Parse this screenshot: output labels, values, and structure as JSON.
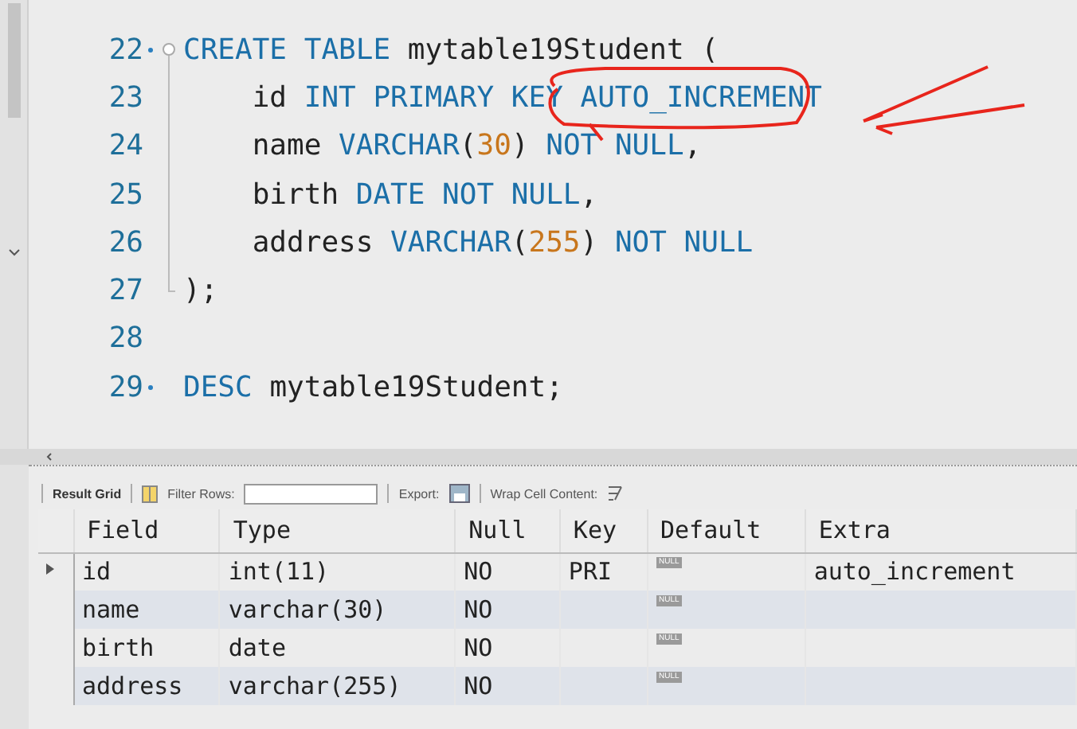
{
  "editor": {
    "lines": [
      {
        "number": "22",
        "marker": true,
        "kind": "fold-start",
        "tokens": [
          {
            "text": "CREATE TABLE",
            "kind": "keyword"
          },
          {
            "text": " mytable19Student (",
            "kind": "ident"
          }
        ]
      },
      {
        "number": "23",
        "marker": false,
        "kind": "fold-body",
        "tokens": [
          {
            "text": "    id ",
            "kind": "ident"
          },
          {
            "text": "INT PRIMARY KEY AUTO_INCREMENT",
            "kind": "keyword"
          }
        ]
      },
      {
        "number": "24",
        "marker": false,
        "kind": "fold-body",
        "tokens": [
          {
            "text": "    name ",
            "kind": "ident"
          },
          {
            "text": "VARCHAR",
            "kind": "keyword"
          },
          {
            "text": "(",
            "kind": "ident"
          },
          {
            "text": "30",
            "kind": "number"
          },
          {
            "text": ") ",
            "kind": "ident"
          },
          {
            "text": "NOT NULL",
            "kind": "keyword"
          },
          {
            "text": ",",
            "kind": "ident"
          }
        ]
      },
      {
        "number": "25",
        "marker": false,
        "kind": "fold-body",
        "tokens": [
          {
            "text": "    birth ",
            "kind": "ident"
          },
          {
            "text": "DATE NOT NULL",
            "kind": "keyword"
          },
          {
            "text": ",",
            "kind": "ident"
          }
        ]
      },
      {
        "number": "26",
        "marker": false,
        "kind": "fold-body",
        "tokens": [
          {
            "text": "    address ",
            "kind": "ident"
          },
          {
            "text": "VARCHAR",
            "kind": "keyword"
          },
          {
            "text": "(",
            "kind": "ident"
          },
          {
            "text": "255",
            "kind": "number"
          },
          {
            "text": ") ",
            "kind": "ident"
          },
          {
            "text": "NOT NULL",
            "kind": "keyword"
          }
        ]
      },
      {
        "number": "27",
        "marker": false,
        "kind": "fold-end",
        "tokens": [
          {
            "text": ");",
            "kind": "ident"
          }
        ]
      },
      {
        "number": "28",
        "marker": false,
        "kind": "plain"
      },
      {
        "number": "29",
        "marker": true,
        "kind": "plain",
        "tokens": [
          {
            "text": "DESC",
            "kind": "keyword"
          },
          {
            "text": " mytable19Student;",
            "kind": "ident"
          }
        ]
      }
    ]
  },
  "results": {
    "toolbar": {
      "result_grid": "Result Grid",
      "filter_label": "Filter Rows:",
      "export_label": "Export:",
      "wrap_label": "Wrap Cell Content:"
    },
    "columns": [
      {
        "label": "Field",
        "kind": "text"
      },
      {
        "label": "Type",
        "kind": "text"
      },
      {
        "label": "Null",
        "kind": "text"
      },
      {
        "label": "Key",
        "kind": "text"
      },
      {
        "label": "Default",
        "kind": "null-badge"
      },
      {
        "label": "Extra",
        "kind": "text"
      }
    ],
    "rows": [
      {
        "selected": true,
        "cells": [
          "id",
          "int(11)",
          "NO",
          "PRI",
          "NULL",
          "auto_increment"
        ]
      },
      {
        "selected": false,
        "cells": [
          "name",
          "varchar(30)",
          "NO",
          "",
          "NULL",
          ""
        ]
      },
      {
        "selected": false,
        "cells": [
          "birth",
          "date",
          "NO",
          "",
          "NULL",
          ""
        ]
      },
      {
        "selected": false,
        "cells": [
          "address",
          "varchar(255)",
          "NO",
          "",
          "NULL",
          ""
        ]
      }
    ]
  }
}
